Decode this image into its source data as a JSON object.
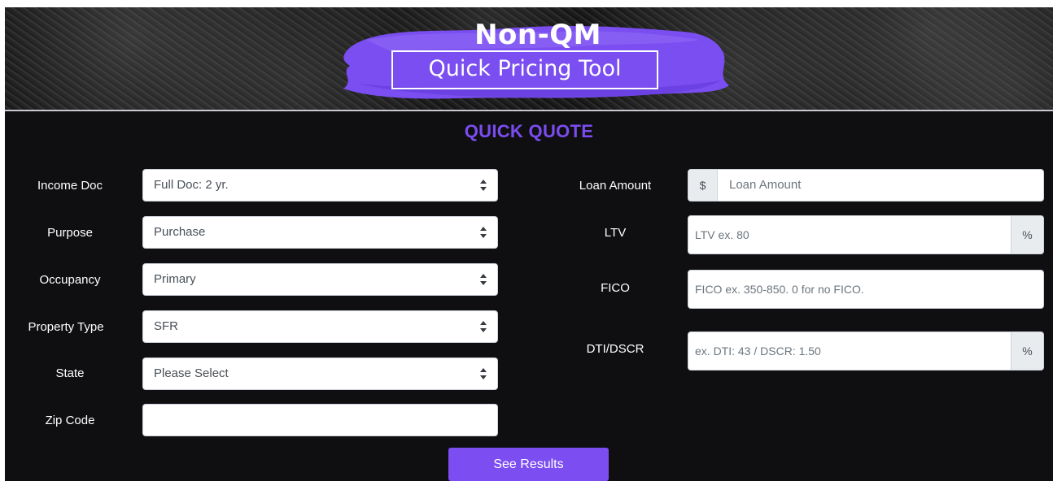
{
  "banner": {
    "title": "Non-QM",
    "subtitle": "Quick Pricing Tool"
  },
  "section_title": "QUICK QUOTE",
  "left_fields": {
    "income_doc": {
      "label": "Income Doc",
      "value": "Full Doc: 2 yr."
    },
    "purpose": {
      "label": "Purpose",
      "value": "Purchase"
    },
    "occupancy": {
      "label": "Occupancy",
      "value": "Primary"
    },
    "property_type": {
      "label": "Property Type",
      "value": "SFR"
    },
    "state": {
      "label": "State",
      "value": "Please Select"
    },
    "zip_code": {
      "label": "Zip Code",
      "value": ""
    }
  },
  "right_fields": {
    "loan_amount": {
      "label": "Loan Amount",
      "prefix": "$",
      "placeholder": "Loan Amount"
    },
    "ltv": {
      "label": "LTV",
      "placeholder": "LTV ex. 80",
      "suffix": "%"
    },
    "fico": {
      "label": "FICO",
      "placeholder": "FICO ex. 350-850. 0 for no FICO."
    },
    "dti_dscr": {
      "label": "DTI/DSCR",
      "placeholder": "ex. DTI: 43 / DSCR: 1.50",
      "suffix": "%"
    }
  },
  "submit_label": "See Results",
  "colors": {
    "accent": "#7c4df1",
    "heading": "#7b4cf0",
    "background": "#0f0f12"
  },
  "icons": {
    "select_caret": "updown-caret-icon"
  }
}
